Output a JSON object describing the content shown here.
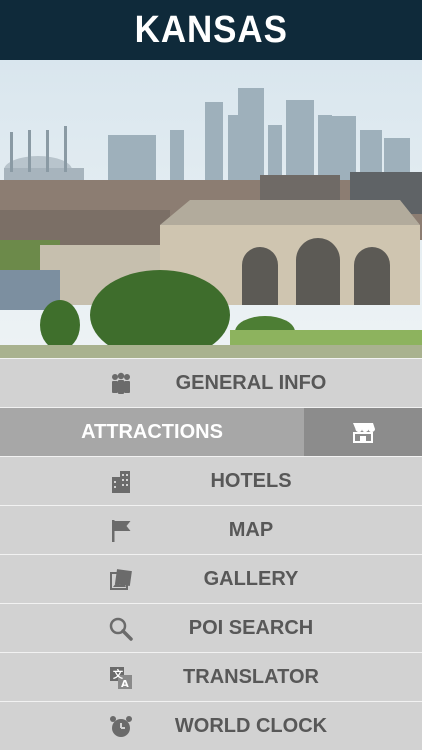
{
  "header": {
    "title": "KANSAS"
  },
  "hero": {
    "image": "Kansas City skyline and Union Station photo"
  },
  "menu": {
    "items": [
      {
        "label": "GENERAL INFO",
        "icon": "people-icon"
      },
      {
        "label": "ATTRACTIONS",
        "icon": "store-icon",
        "active": true
      },
      {
        "label": "HOTELS",
        "icon": "building-icon"
      },
      {
        "label": "MAP",
        "icon": "flag-icon"
      },
      {
        "label": "GALLERY",
        "icon": "photos-icon"
      },
      {
        "label": "POI SEARCH",
        "icon": "magnifier-icon"
      },
      {
        "label": "TRANSLATOR",
        "icon": "translate-icon"
      },
      {
        "label": "WORLD CLOCK",
        "icon": "alarm-clock-icon"
      }
    ]
  },
  "colors": {
    "header": "#0f2a3a",
    "row": "#d2d2d2",
    "active": "#a7a7a7",
    "active_side": "#8c8c8c",
    "text": "#585858"
  }
}
